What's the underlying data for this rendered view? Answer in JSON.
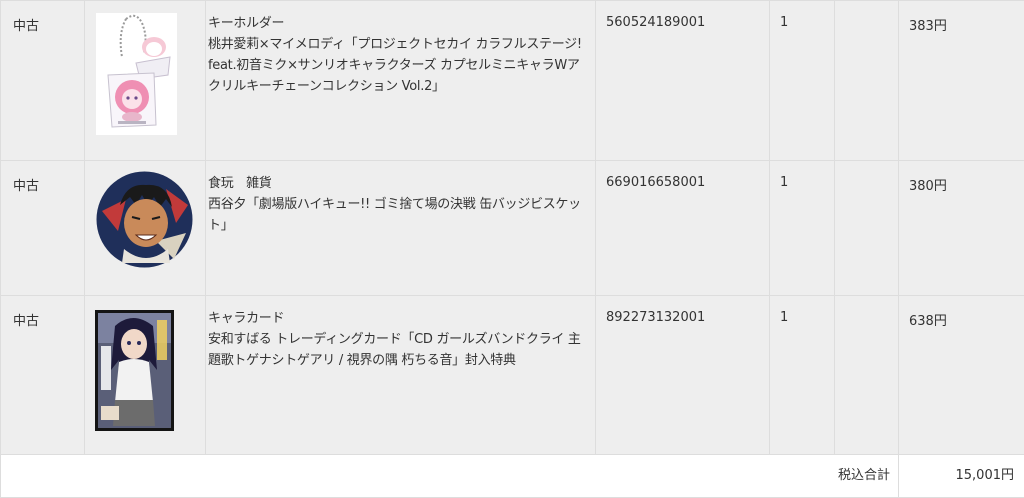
{
  "order_items": [
    {
      "condition": "中古",
      "category": "キーホルダー",
      "title": "桃井愛莉×マイメロディ「プロジェクトセカイ カラフルステージ! feat.初音ミク×サンリオキャラクターズ カプセルミニキャラWアクリルキーチェーンコレクション Vol.2」",
      "item_code": "560524189001",
      "quantity": "1",
      "price": "383円",
      "image_icon": "acrylic-keychain-thumbnail"
    },
    {
      "condition": "中古",
      "category": "食玩　雑貨",
      "title": "西谷夕「劇場版ハイキュー!! ゴミ捨て場の決戦 缶バッジビスケット」",
      "item_code": "669016658001",
      "quantity": "1",
      "price": "380円",
      "image_icon": "can-badge-thumbnail"
    },
    {
      "condition": "中古",
      "category": "キャラカード",
      "title": "安和すばる トレーディングカード「CD ガールズバンドクライ 主題歌トゲナシトゲアリ / 視界の隅 朽ちる音」封入特典",
      "item_code": "892273132001",
      "quantity": "1",
      "price": "638円",
      "image_icon": "trading-card-thumbnail"
    }
  ],
  "total": {
    "label": "税込合計",
    "value": "15,001円"
  }
}
